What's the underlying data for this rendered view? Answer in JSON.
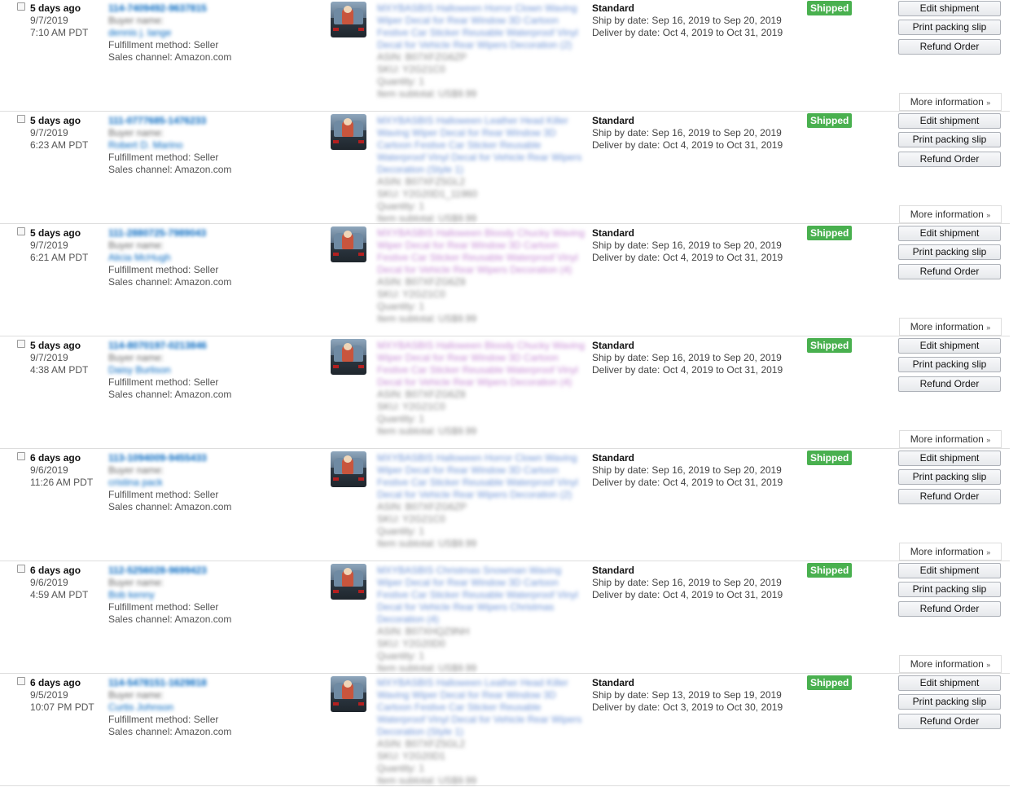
{
  "labels": {
    "fulfillment_prefix": "Fulfillment method: ",
    "sales_prefix": "Sales channel: ",
    "buyer_name_label": "Buyer name:",
    "ship_prefix": "Ship by date: ",
    "deliver_prefix": "Deliver by date: ",
    "edit_shipment": "Edit shipment",
    "print_packing_slip": "Print packing slip",
    "refund_order": "Refund Order",
    "more_information": "More information",
    "more_chevron": "»",
    "status_shipped": "Shipped"
  },
  "product_meta": {
    "asin_label": "ASIN:",
    "sku_label": "SKU:",
    "quantity_label": "Quantity:",
    "subtotal_label": "Item subtotal:"
  },
  "orders": [
    {
      "age": "5 days ago",
      "date": "9/7/2019",
      "time": "7:10 AM PDT",
      "order_id": "114-7409492-9637815",
      "buyer": "dennis j. lange",
      "fulfillment": "Seller",
      "channel": "Amazon.com",
      "product_title": "MXYBASBIS Halloween Horror Clown Waving Wiper Decal for Rear Window 3D Cartoon Festive Car Sticker Reusable Waterproof Vinyl Decal for Vehicle Rear Wipers Decoration (2)",
      "asin": "B07XFZG6ZP",
      "sku": "Y2G21C0",
      "quantity": "1",
      "subtotal": "US$9.99",
      "service": "Standard",
      "ship_by": "Sep 16, 2019 to Sep 20, 2019",
      "deliver_by": "Oct 4, 2019 to Oct 31, 2019",
      "status": "Shipped"
    },
    {
      "age": "5 days ago",
      "date": "9/7/2019",
      "time": "6:23 AM PDT",
      "order_id": "111-0777685-1476233",
      "buyer": "Robert D. Marino",
      "fulfillment": "Seller",
      "channel": "Amazon.com",
      "product_title": "MXYBASBIS Halloween Leather Head Killer Waving Wiper Decal for Rear Window 3D Cartoon Festive Car Sticker Reusable Waterproof Vinyl Decal for Vehicle Rear Wipers Decoration (Style 1)",
      "asin": "B07XFZ5GL2",
      "sku": "Y2G20D1_11960",
      "quantity": "1",
      "subtotal": "US$9.99",
      "service": "Standard",
      "ship_by": "Sep 16, 2019 to Sep 20, 2019",
      "deliver_by": "Oct 4, 2019 to Oct 31, 2019",
      "status": "Shipped"
    },
    {
      "age": "5 days ago",
      "date": "9/7/2019",
      "time": "6:21 AM PDT",
      "order_id": "111-2880725-7989043",
      "buyer": "Alicia McHugh",
      "fulfillment": "Seller",
      "channel": "Amazon.com",
      "product_title": "MXYBASBIS Halloween Bloody Chucky Waving Wiper Decal for Rear Window 3D Cartoon Festive Car Sticker Reusable Waterproof Vinyl Decal for Vehicle Rear Wipers Decoration (4)",
      "asin": "B07XFZG6Z8",
      "sku": "Y2G21C0",
      "quantity": "1",
      "subtotal": "US$9.99",
      "service": "Standard",
      "ship_by": "Sep 16, 2019 to Sep 20, 2019",
      "deliver_by": "Oct 4, 2019 to Oct 31, 2019",
      "status": "Shipped"
    },
    {
      "age": "5 days ago",
      "date": "9/7/2019",
      "time": "4:38 AM PDT",
      "order_id": "114-8070197-0213846",
      "buyer": "Daisy Burlison",
      "fulfillment": "Seller",
      "channel": "Amazon.com",
      "product_title": "MXYBASBIS Halloween Bloody Chucky Waving Wiper Decal for Rear Window 3D Cartoon Festive Car Sticker Reusable Waterproof Vinyl Decal for Vehicle Rear Wipers Decoration (4)",
      "asin": "B07XFZG6Z8",
      "sku": "Y2G21C0",
      "quantity": "1",
      "subtotal": "US$9.99",
      "service": "Standard",
      "ship_by": "Sep 16, 2019 to Sep 20, 2019",
      "deliver_by": "Oct 4, 2019 to Oct 31, 2019",
      "status": "Shipped"
    },
    {
      "age": "6 days ago",
      "date": "9/6/2019",
      "time": "11:26 AM PDT",
      "order_id": "113-1094009-9455433",
      "buyer": "cristina pack",
      "fulfillment": "Seller",
      "channel": "Amazon.com",
      "product_title": "MXYBASBIS Halloween Horror Clown Waving Wiper Decal for Rear Window 3D Cartoon Festive Car Sticker Reusable Waterproof Vinyl Decal for Vehicle Rear Wipers Decoration (2)",
      "asin": "B07XFZG6ZP",
      "sku": "Y2G21C0",
      "quantity": "1",
      "subtotal": "US$9.99",
      "service": "Standard",
      "ship_by": "Sep 16, 2019 to Sep 20, 2019",
      "deliver_by": "Oct 4, 2019 to Oct 31, 2019",
      "status": "Shipped"
    },
    {
      "age": "6 days ago",
      "date": "9/6/2019",
      "time": "4:59 AM PDT",
      "order_id": "112-5256028-9699423",
      "buyer": "Bob kenny",
      "fulfillment": "Seller",
      "channel": "Amazon.com",
      "product_title": "MXYBASBIS Christmas Snowman Waving Wiper Decal for Rear Window 3D Cartoon Festive Car Sticker Reusable Waterproof Vinyl Decal for Vehicle Rear Wipers Christmas Decoration (4)",
      "asin": "B07XHQZ9NH",
      "sku": "Y2G20D0",
      "quantity": "1",
      "subtotal": "US$9.99",
      "service": "Standard",
      "ship_by": "Sep 16, 2019 to Sep 20, 2019",
      "deliver_by": "Oct 4, 2019 to Oct 31, 2019",
      "status": "Shipped"
    },
    {
      "age": "6 days ago",
      "date": "9/5/2019",
      "time": "10:07 PM PDT",
      "order_id": "114-5478151-1629818",
      "buyer": "Curtis Johnson",
      "fulfillment": "Seller",
      "channel": "Amazon.com",
      "product_title": "MXYBASBIS Halloween Leather Head Killer Waving Wiper Decal for Rear Window 3D Cartoon Festive Car Sticker Reusable Waterproof Vinyl Decal for Vehicle Rear Wipers Decoration (Style 1)",
      "asin": "B07XFZ5GL2",
      "sku": "Y2G20D1",
      "quantity": "1",
      "subtotal": "US$9.99",
      "service": "Standard",
      "ship_by": "Sep 13, 2019 to Sep 19, 2019",
      "deliver_by": "Oct 3, 2019 to Oct 30, 2019",
      "status": "Shipped"
    }
  ]
}
